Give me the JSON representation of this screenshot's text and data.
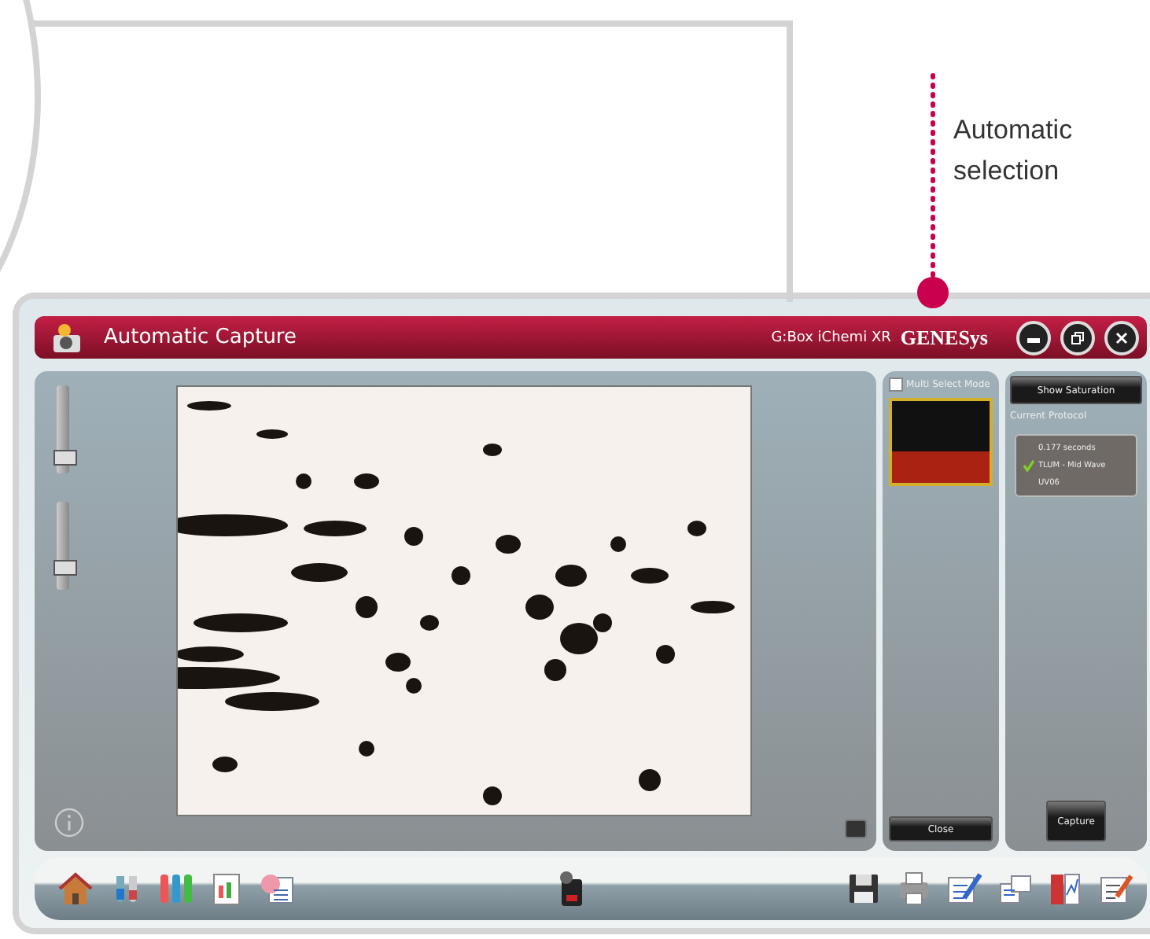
{
  "callout": {
    "text": "Automatic selection"
  },
  "window": {
    "title": "Automatic Capture",
    "product": "G:Box iChemi XR",
    "brand": "GENESys"
  },
  "sliders": [
    {
      "level": 0.12
    },
    {
      "level": 0.2
    }
  ],
  "multi_select": {
    "label": "Multi Select Mode",
    "checked": false
  },
  "buttons": {
    "show_saturation": "Show Saturation",
    "close": "Close",
    "capture": "Capture"
  },
  "current_protocol": {
    "label": "Current Protocol",
    "items": [
      {
        "text": "0.177 seconds",
        "checked": false
      },
      {
        "text": "TLUM - Mid Wave",
        "checked": true
      },
      {
        "text": "UV06",
        "checked": false
      }
    ]
  }
}
